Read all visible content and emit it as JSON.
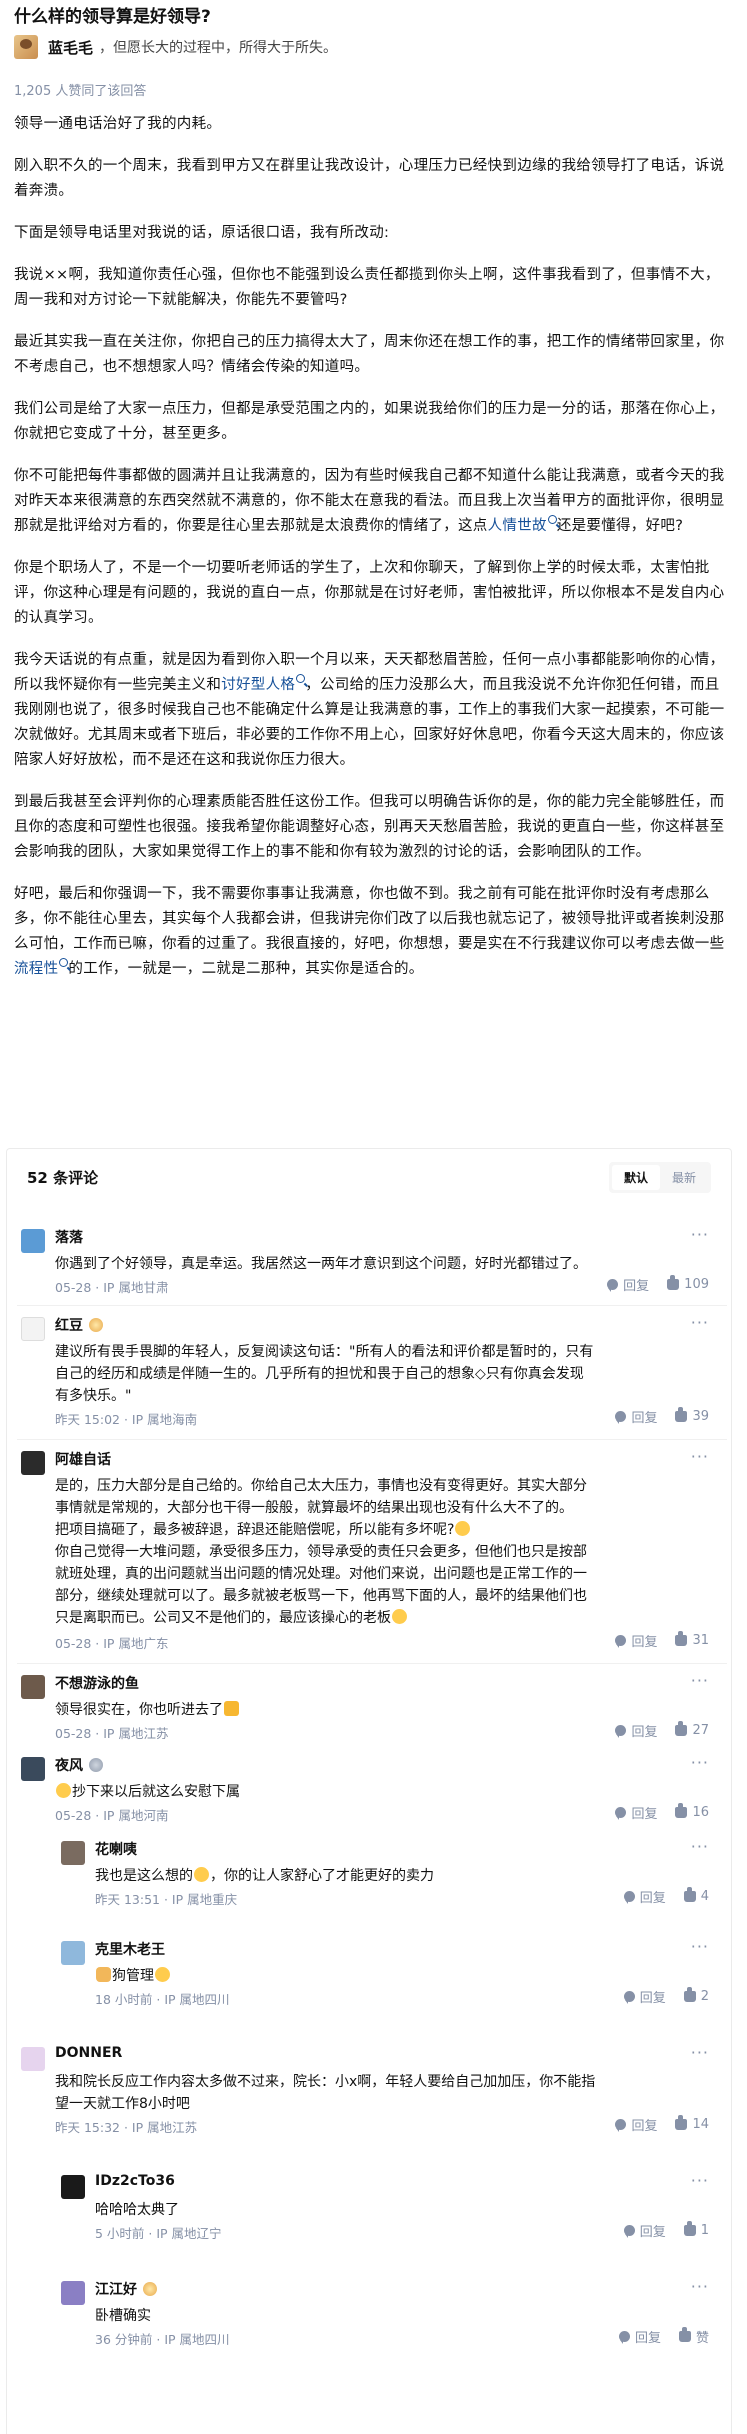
{
  "question": {
    "title": "什么样的领导算是好领导?"
  },
  "author": {
    "name": "蓝毛毛",
    "sep": "，",
    "bio": "但愿长大的过程中，所得大于所失。"
  },
  "votes": "1,205 人赞同了该回答",
  "answer": {
    "p1": "领导一通电话治好了我的内耗。",
    "p2": "刚入职不久的一个周末，我看到甲方又在群里让我改设计，心理压力已经快到边缘的我给领导打了电话，诉说着奔溃。",
    "p3": "下面是领导电话里对我说的话，原话很口语，我有所改动:",
    "p4": "我说××啊，我知道你责任心强，但你也不能强到设么责任都揽到你头上啊，这件事我看到了，但事情不大，周一我和对方讨论一下就能解决，你能先不要管吗?",
    "p5": "最近其实我一直在关注你，你把自己的压力搞得太大了，周末你还在想工作的事，把工作的情绪带回家里，你不考虑自己，也不想想家人吗？情绪会传染的知道吗。",
    "p6": "我们公司是给了大家一点压力，但都是承受范围之内的，如果说我给你们的压力是一分的话，那落在你心上，你就把它变成了十分，甚至更多。",
    "p7a": "你不可能把每件事都做的圆满并且让我满意的，因为有些时候我自己都不知道什么能让我满意，或者今天的我对昨天本来很满意的东西突然就不满意的，你不能太在意我的看法。而且我上次当着甲方的面批评你，很明显那就是批评给对方看的，你要是往心里去那就是太浪费你的情绪了，这点",
    "p7link": "人情世故",
    "p7b": "还是要懂得，好吧?",
    "p8": "你是个职场人了，不是一个一切要听老师话的学生了，上次和你聊天，了解到你上学的时候太乖，太害怕批评，你这种心理是有问题的，我说的直白一点，你那就是在讨好老师，害怕被批评，所以你根本不是发自内心的认真学习。",
    "p9a": "我今天话说的有点重，就是因为看到你入职一个月以来，天天都愁眉苦脸，任何一点小事都能影响你的心情，所以我怀疑你有一些完美主义和",
    "p9link": "讨好型人格",
    "p9b": "，公司给的压力没那么大，而且我没说不允许你犯任何错，而且我刚刚也说了，很多时候我自己也不能确定什么算是让我满意的事，工作上的事我们大家一起摸索，不可能一次就做好。尤其周末或者下班后，非必要的工作你不用上心，回家好好休息吧，你看今天这大周末的，你应该陪家人好好放松，而不是还在这和我说你压力很大。",
    "p10": "到最后我甚至会评判你的心理素质能否胜任这份工作。但我可以明确告诉你的是，你的能力完全能够胜任，而且你的态度和可塑性也很强。接我希望你能调整好心态，别再天天愁眉苦脸，我说的更直白一些，你这样甚至会影响我的团队，大家如果觉得工作上的事不能和你有较为激烈的讨论的话，会影响团队的工作。",
    "p11a": "好吧，最后和你强调一下，我不需要你事事让我满意，你也做不到。我之前有可能在批评你时没有考虑那么多，你不能往心里去，其实每个人我都会讲，但我讲完你们改了以后我也就忘记了，被领导批评或者挨刺没那么可怕，工作而已嘛，你看的过重了。我很直接的，好吧，你想想，要是实在不行我建议你可以考虑去做一些",
    "p11link": "流程性",
    "p11b": "的工作，一就是一，二就是二那种，其实你是适合的。"
  },
  "comments": {
    "count_label": "52 条评论",
    "sort_default": "默认",
    "sort_latest": "最新",
    "reply_label": "回复",
    "more_label": "···",
    "items": [
      {
        "name": "落落",
        "text": "你遇到了个好领导，真是幸运。我居然这一两年才意识到这个问题，好时光都错过了。",
        "date": "05-28",
        "location": "IP 属地甘肃",
        "likes": "109"
      },
      {
        "name": "红豆",
        "text1": "建议所有畏手畏脚的年轻人，反复阅读这句话：\"所有人的看法和评价都是暂时的，只有",
        "text2": "自己的经历和成绩是伴随一生的。几乎所有的担忧和畏于自己的想象◇只有你真会发现",
        "text3": "有多快乐。\"",
        "date": "昨天 15:02",
        "location": "IP 属地海南",
        "likes": "39"
      },
      {
        "name": "阿雄自话",
        "text1": "是的，压力大部分是自己给的。你给自己太大压力，事情也没有变得更好。其实大部分",
        "text2": "事情就是常规的，大部分也干得一般般，就算最坏的结果出现也没有什么大不了的。",
        "text3": "把项目搞砸了，最多被辞退，辞退还能赔偿呢，所以能有多坏呢?",
        "text4": "你自己觉得一大堆问题，承受很多压力，领导承受的责任只会更多，但他们也只是按部",
        "text5": "就班处理，真的出问题就当出问题的情况处理。对他们来说，出问题也是正常工作的一",
        "text6": "部分，继续处理就可以了。最多就被老板骂一下，他再骂下面的人，最坏的结果他们也",
        "text7": "只是离职而已。公司又不是他们的，最应该操心的老板",
        "date": "05-28",
        "location": "IP 属地广东",
        "likes": "31"
      },
      {
        "name": "不想游泳的鱼",
        "text": "领导很实在，你也听进去了",
        "date": "05-28",
        "location": "IP 属地江苏",
        "likes": "27"
      },
      {
        "name": "夜风",
        "text": "抄下来以后就这么安慰下属",
        "date": "05-28",
        "location": "IP 属地河南",
        "likes": "16"
      },
      {
        "name": "花喇咦",
        "text": "我也是这么想的",
        "text2": "，你的让人家舒心了才能更好的卖力",
        "date": "昨天 13:51",
        "location": "IP 属地重庆",
        "likes": "4"
      },
      {
        "name": "克里木老王",
        "text": "狗管理",
        "date": "18 小时前",
        "location": "IP 属地四川",
        "likes": "2"
      },
      {
        "name": "DONNER",
        "text1": "我和院长反应工作内容太多做不过来，院长：小x啊，年轻人要给自己加加压，你不能指",
        "text2": "望一天就工作8小时吧",
        "date": "昨天 15:32",
        "location": "IP 属地江苏",
        "likes": "14"
      },
      {
        "name": "IDz2cTo36",
        "text": "哈哈哈太典了",
        "date": "5 小时前",
        "location": "IP 属地辽宁",
        "likes": "1"
      },
      {
        "name": "江江好",
        "text": "卧槽确实",
        "date": "36 分钟前",
        "location": "IP 属地四川",
        "likes": "赞"
      }
    ]
  },
  "colors": {
    "link": "#175199",
    "meta": "#8590a6",
    "text": "#121212"
  }
}
